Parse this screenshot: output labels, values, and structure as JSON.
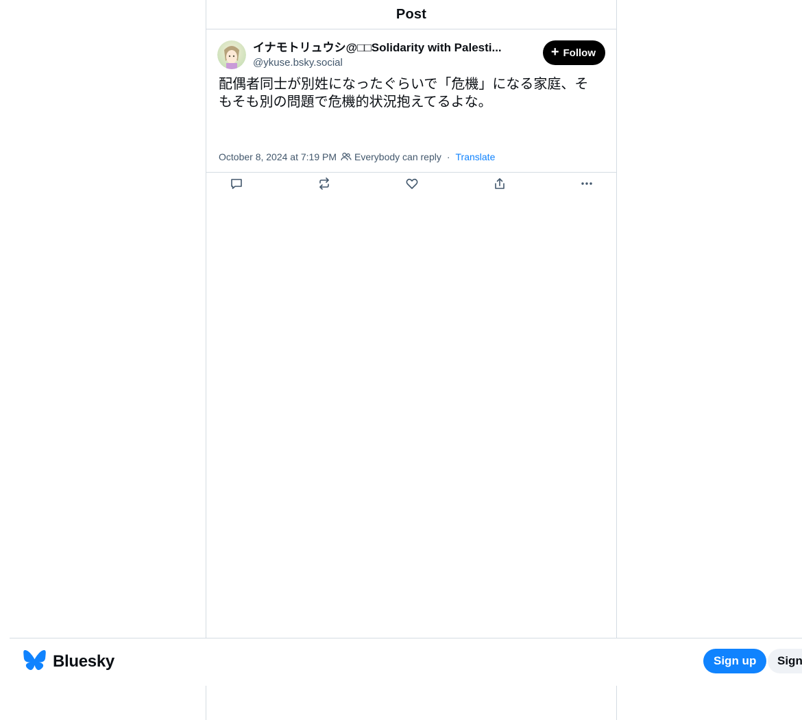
{
  "header": {
    "title": "Post"
  },
  "post": {
    "author": {
      "display_name": "イナモトリュウシ@□□Solidarity with Palesti...",
      "handle": "@ykuse.bsky.social",
      "avatar_icon": "avatar-image"
    },
    "follow_label": "Follow",
    "text_line1": "配偶者同士が別姓になったぐらいで「危機」になる家庭、そ",
    "text_line2": "もそも別の問題で危機的状況抱えてるよな。",
    "timestamp": "October 8, 2024 at 7:19 PM",
    "reply_setting": "Everybody can reply",
    "separator": "·",
    "translate_label": "Translate",
    "actions": [
      "reply-icon",
      "repost-icon",
      "like-icon",
      "share-icon",
      "more-icon"
    ]
  },
  "footer": {
    "brand": "Bluesky",
    "signup_label": "Sign up",
    "signin_label": "Sign in"
  },
  "colors": {
    "accent": "#1083fe",
    "border": "#d4dbe2",
    "muted_text": "#42576c",
    "follow_bg": "#000000"
  }
}
